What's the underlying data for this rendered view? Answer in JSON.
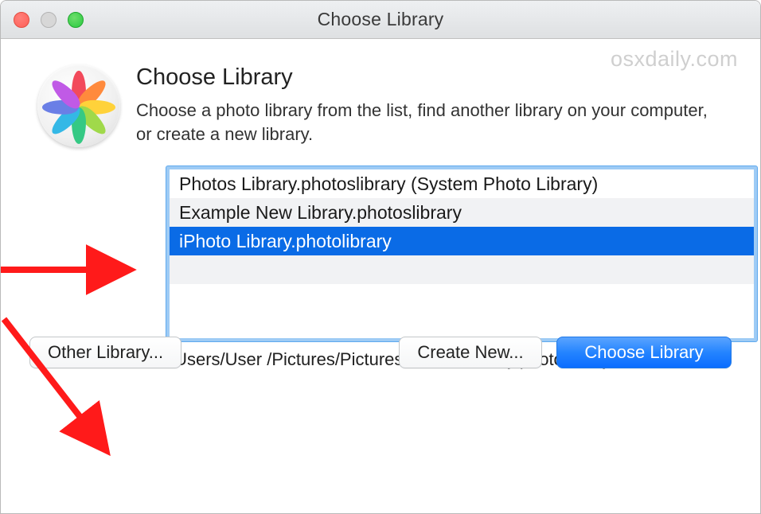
{
  "window": {
    "title": "Choose Library"
  },
  "watermark": "osxdaily.com",
  "header": {
    "title": "Choose Library",
    "desc": "Choose a photo library from the list, find another library on your computer, or create a new library."
  },
  "icon": {
    "petals": [
      "#f24a5b",
      "#ff8a3c",
      "#ffd23a",
      "#a0d94a",
      "#35c984",
      "#34b8e6",
      "#6a7fe6",
      "#c05ae6"
    ]
  },
  "list": {
    "items": [
      {
        "label": "Photos Library.photoslibrary (System Photo Library)",
        "selected": false
      },
      {
        "label": "Example New Library.photoslibrary",
        "selected": false
      },
      {
        "label": "iPhoto Library.photolibrary",
        "selected": true
      },
      {
        "label": "",
        "selected": false
      },
      {
        "label": "",
        "selected": false
      }
    ],
    "path": "/Users/User /Pictures/Pictures/iPhoto Library.photolibrary"
  },
  "buttons": {
    "other": "Other Library...",
    "create": "Create New...",
    "choose": "Choose Library"
  }
}
